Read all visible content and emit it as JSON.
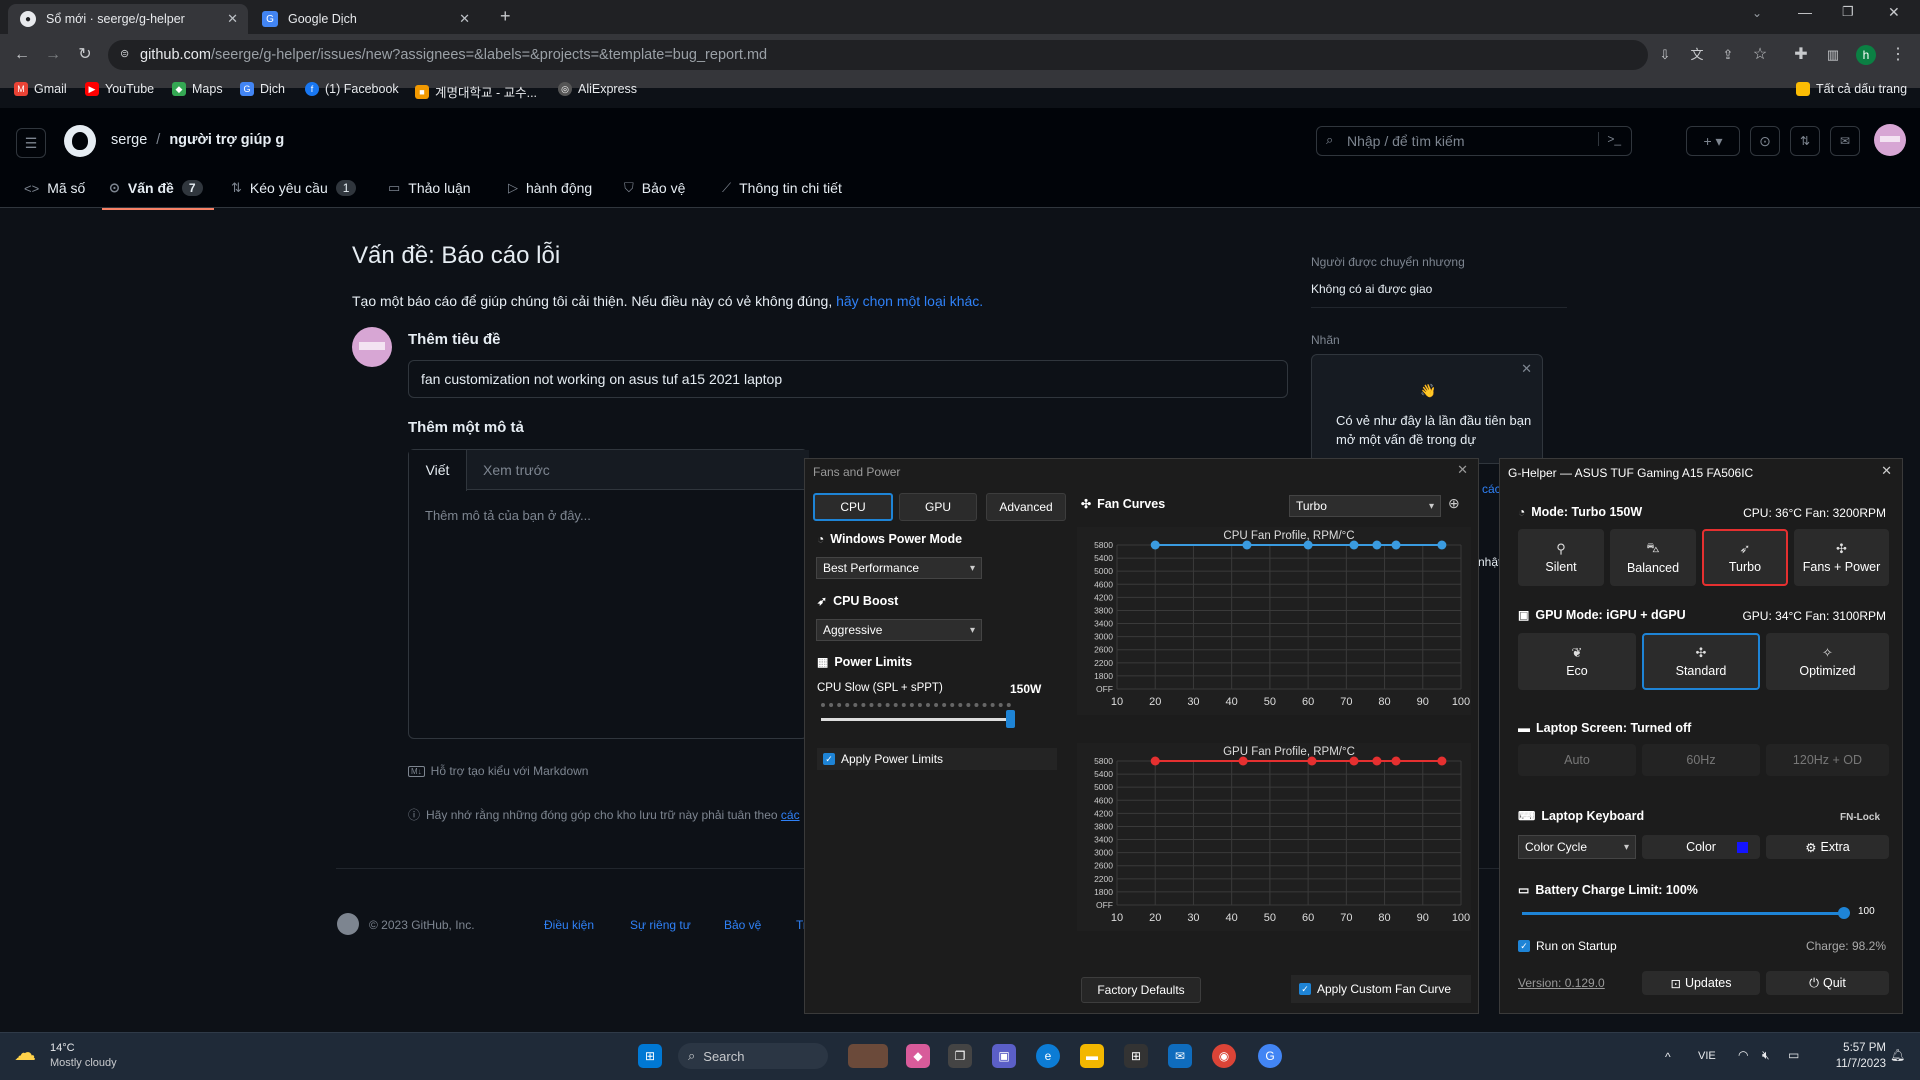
{
  "browser": {
    "tabs": [
      {
        "label": "Sổ mới · seerge/g-helper"
      },
      {
        "label": "Google Dịch"
      }
    ],
    "url_domain": "github.com",
    "url_path": "/seerge/g-helper/issues/new?assignees=&labels=&projects=&template=bug_report.md",
    "bookmarks": [
      "Gmail",
      "YouTube",
      "Maps",
      "Dịch",
      "(1) Facebook",
      "계명대학교 - 교수...",
      "AliExpress"
    ],
    "all_bookmarks": "Tất cả dấu trang",
    "profile_initial": "h"
  },
  "github": {
    "owner": "serge",
    "repo": "người trợ giúp g",
    "search_placeholder": "Nhập / để tìm kiếm",
    "nav": [
      {
        "label": "Mã số"
      },
      {
        "label": "Vấn đề",
        "count": "7"
      },
      {
        "label": "Kéo yêu cầu",
        "count": "1"
      },
      {
        "label": "Thảo luận"
      },
      {
        "label": "hành động"
      },
      {
        "label": "Bảo vệ"
      },
      {
        "label": "Thông tin chi tiết"
      }
    ],
    "page_title": "Vấn đề: Báo cáo lỗi",
    "intro_text": "Tạo một báo cáo để giúp chúng tôi cải thiện. Nếu điều này có vẻ không đúng,",
    "intro_link": "hãy chọn một loại khác.",
    "title_label": "Thêm tiêu đề",
    "title_value": "fan customization not working on asus tuf a15 2021 laptop",
    "desc_label": "Thêm một mô tả",
    "tab_write": "Viết",
    "tab_preview": "Xem trước",
    "desc_placeholder": "Thêm mô tả của bạn ở đây...",
    "markdown_note": "Hỗ trợ tạo kiểu với Markdown",
    "contrib_note": "Hãy nhớ rằng những đóng góp cho kho lưu trữ này phải tuân theo",
    "contrib_link": "các",
    "assignees_label": "Người được chuyển nhượng",
    "assignees_value": "Không có ai được giao",
    "labels_label": "Nhãn",
    "popup_emoji": "👋",
    "popup_text": "Có vẻ như đây là lần đầu tiên bạn mở một vấn đề trong dự",
    "popup_right_1": "các",
    "popup_right_2": "nhật",
    "footer_copy": "© 2023 GitHub, Inc.",
    "footer_links": [
      "Điều kiện",
      "Sự riêng tư",
      "Bảo vệ",
      "Tr"
    ]
  },
  "fans": {
    "title": "Fans and Power",
    "tabs": [
      "CPU",
      "GPU",
      "Advanced"
    ],
    "fan_curves_label": "Fan Curves",
    "profile": "Turbo",
    "windows_power_label": "Windows Power Mode",
    "windows_power_value": "Best Performance",
    "cpu_boost_label": "CPU Boost",
    "cpu_boost_value": "Aggressive",
    "power_limits_label": "Power Limits",
    "cpu_slow_label": "CPU Slow (SPL + sPPT)",
    "cpu_slow_value": "150W",
    "cpu_slow_fraction": 1.0,
    "apply_power_label": "Apply Power Limits",
    "factory_defaults": "Factory Defaults",
    "apply_custom": "Apply Custom Fan Curve"
  },
  "chart_data": [
    {
      "type": "line",
      "title": "CPU Fan Profile, RPM/°C",
      "color": "#3a9be0",
      "x": [
        20,
        44,
        60,
        72,
        78,
        83,
        95
      ],
      "y": [
        5800,
        5800,
        5800,
        5800,
        5800,
        5800,
        5800
      ],
      "xlim": [
        10,
        100
      ],
      "ylim": [
        0,
        5800
      ],
      "xticks": [
        "10",
        "20",
        "30",
        "40",
        "50",
        "60",
        "70",
        "80",
        "90",
        "100"
      ],
      "yticks": [
        "OFF",
        "1800",
        "2200",
        "2600",
        "3000",
        "3400",
        "3800",
        "4200",
        "4600",
        "5000",
        "5400",
        "5800"
      ]
    },
    {
      "type": "line",
      "title": "GPU Fan Profile, RPM/°C",
      "color": "#e53030",
      "x": [
        20,
        43,
        61,
        72,
        78,
        83,
        95
      ],
      "y": [
        5800,
        5800,
        5800,
        5800,
        5800,
        5800,
        5800
      ],
      "xlim": [
        10,
        100
      ],
      "ylim": [
        0,
        5800
      ],
      "xticks": [
        "10",
        "20",
        "30",
        "40",
        "50",
        "60",
        "70",
        "80",
        "90",
        "100"
      ],
      "yticks": [
        "OFF",
        "1800",
        "2200",
        "2600",
        "3000",
        "3400",
        "3800",
        "4200",
        "4600",
        "5000",
        "5400",
        "5800"
      ]
    }
  ],
  "ghelper": {
    "title": "G-Helper — ASUS TUF Gaming A15 FA506IC",
    "mode_label": "Mode: Turbo 150W",
    "cpu_status": "CPU: 36°C Fan: 3200RPM",
    "modes": [
      "Silent",
      "Balanced",
      "Turbo",
      "Fans + Power"
    ],
    "gpu_label": "GPU Mode: iGPU + dGPU",
    "gpu_status": "GPU: 34°C Fan: 3100RPM",
    "gpu_modes": [
      "Eco",
      "Standard",
      "Optimized"
    ],
    "screen_label": "Laptop Screen: Turned off",
    "screen_modes": [
      "Auto",
      "60Hz",
      "120Hz + OD"
    ],
    "keyboard_label": "Laptop Keyboard",
    "fn_lock": "FN-Lock",
    "kb_mode": "Color Cycle",
    "kb_color": "Color",
    "kb_color_value": "#1414ff",
    "kb_extra": "Extra",
    "battery_label": "Battery Charge Limit: 100%",
    "battery_value": "100",
    "battery_fraction": 1.0,
    "startup": "Run on Startup",
    "charge": "Charge: 98.2%",
    "version": "Version: 0.129.0",
    "updates": "Updates",
    "quit": "Quit"
  },
  "taskbar": {
    "temp": "14°C",
    "weather": "Mostly cloudy",
    "search": "Search",
    "lang": "VIE",
    "time": "5:57 PM",
    "date": "11/7/2023"
  }
}
